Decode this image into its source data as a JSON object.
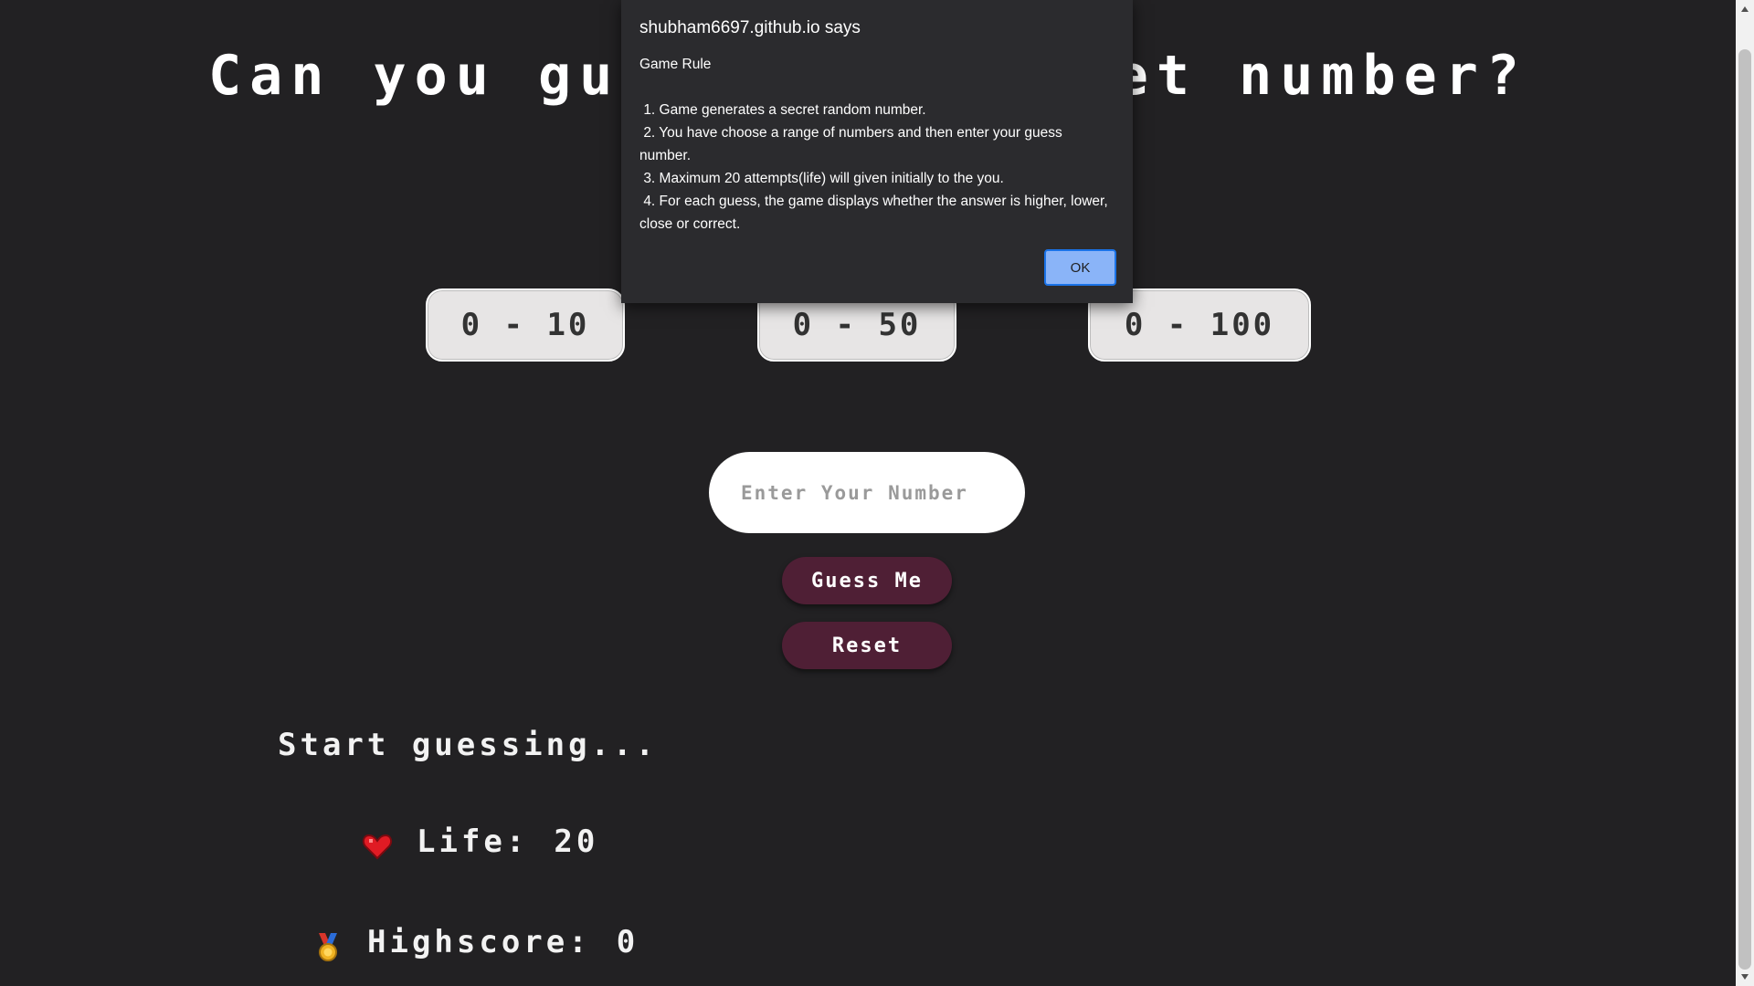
{
  "page": {
    "title": "Can you guess the secret number?"
  },
  "ranges": [
    {
      "label": "0 - 10"
    },
    {
      "label": "0 - 50"
    },
    {
      "label": "0 - 100"
    }
  ],
  "guess": {
    "placeholder": "Enter Your Number",
    "value": "",
    "guess_label": "Guess Me",
    "reset_label": "Reset"
  },
  "status": {
    "message": "Start guessing..."
  },
  "stats": {
    "life_label": "Life:",
    "life_value": "20",
    "life_icon": "heart-icon",
    "highscore_label": "Highscore:",
    "highscore_value": "0",
    "highscore_icon": "medal-icon"
  },
  "dialog": {
    "origin": "shubham6697.github.io says",
    "heading": "Game Rule",
    "rules": [
      " 1. Game generates a secret random number.",
      " 2. You have choose a range of numbers and then enter your guess number.",
      " 3. Maximum 20 attempts(life) will given initially to the you.",
      " 4. For each guess, the game displays whether the answer is higher, lower, close or correct."
    ],
    "ok_label": "OK"
  },
  "colors": {
    "background": "#222123",
    "button_dark": "#4f1f35",
    "range_button": "#e7e5e5",
    "dialog_bg": "#2b2b2e",
    "ok_button": "#8ab4f8"
  }
}
